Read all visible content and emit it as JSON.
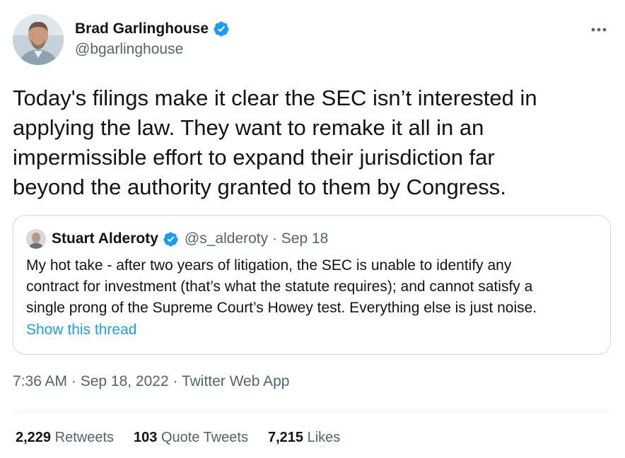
{
  "author": {
    "display_name": "Brad Garlinghouse",
    "handle": "@bgarlinghouse",
    "verified": true
  },
  "tweet": {
    "text": "Today's filings make it clear the SEC isn’t interested in\napplying the law. They want to remake it all in an\nimpermissible effort to expand their jurisdiction far\nbeyond the authority granted to them by Congress."
  },
  "quoted_tweet": {
    "display_name": "Stuart Alderoty",
    "handle": "@s_alderoty",
    "date": "Sep 18",
    "meta": "@s_alderoty · Sep 18",
    "text": "My hot take - after two years of litigation, the SEC is unable to identify any\ncontract for investment (that’s what the statute requires); and cannot satisfy a\nsingle prong of the Supreme Court’s Howey test. Everything else is just noise.",
    "show_thread_label": "Show this thread"
  },
  "meta": {
    "time_date": "7:36 AM · Sep 18, 2022 · ",
    "source": "Twitter Web App"
  },
  "stats": {
    "retweets_count": "2,229",
    "retweets_label": "Retweets",
    "quotes_count": "103",
    "quotes_label": "Quote Tweets",
    "likes_count": "7,215",
    "likes_label": "Likes"
  },
  "colors": {
    "accent": "#1d9bf0",
    "text_primary": "#0f1419",
    "text_secondary": "#536471",
    "border": "#cfd9de"
  },
  "icons": {
    "verified": "verified-badge-icon",
    "more": "more-horizontal-icon"
  }
}
